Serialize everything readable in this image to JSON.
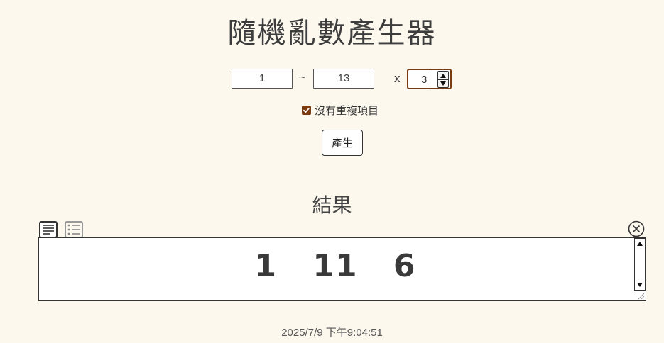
{
  "title": "隨機亂數產生器",
  "range": {
    "min_value": "1",
    "separator": "~",
    "max_value": "13",
    "multiplier_symbol": "x",
    "count_value": "3"
  },
  "options": {
    "no_repeat_label": "沒有重複項目",
    "no_repeat_checked": true
  },
  "generate_button_label": "產生",
  "result": {
    "heading": "結果",
    "output": "1 11 6"
  },
  "timestamp": "2025/7/9 下午9:04:51",
  "colors": {
    "background": "#fdf8ee",
    "accent": "#7a3b10"
  },
  "icons": {
    "text_view": "text-lines-icon",
    "list_view": "list-icon",
    "clear": "close-circle-icon"
  }
}
